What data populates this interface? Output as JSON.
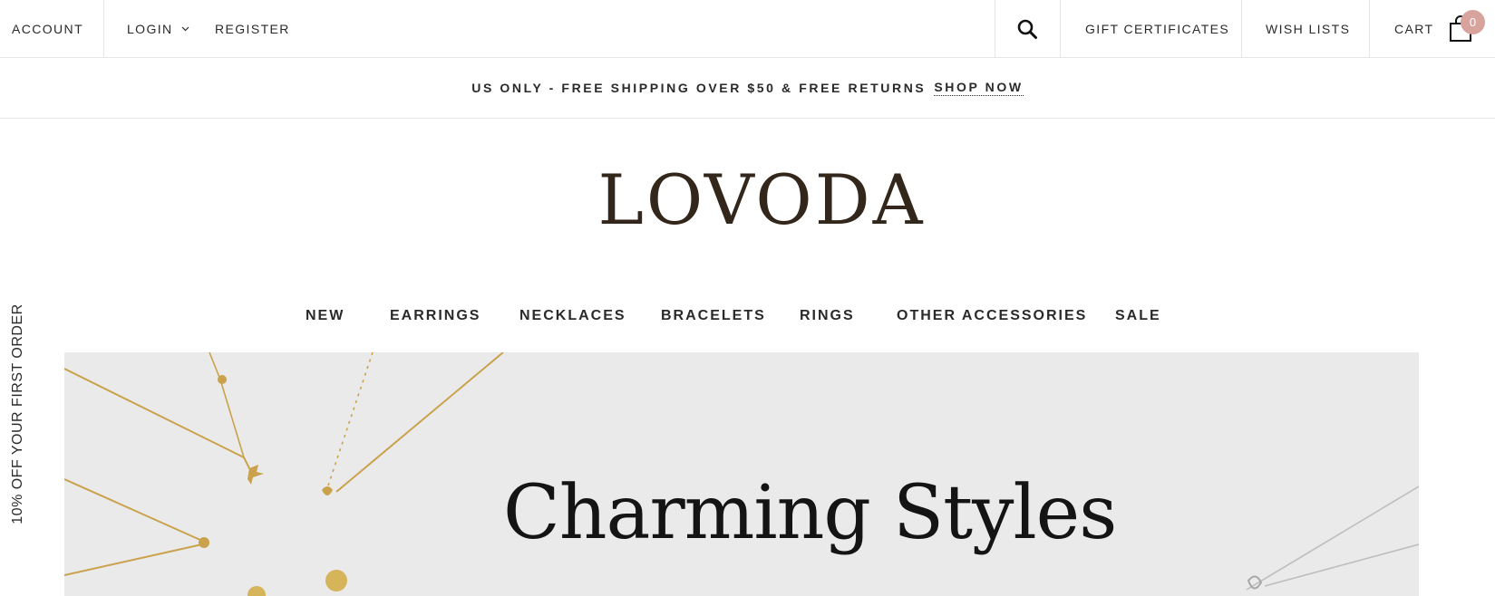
{
  "topbar": {
    "account": "ACCOUNT",
    "login": "LOGIN",
    "register": "REGISTER",
    "gift_certificates": "GIFT CERTIFICATES",
    "wish_lists": "WISH LISTS",
    "cart": "CART",
    "cart_count": "0"
  },
  "announcement": {
    "text": "US ONLY - FREE SHIPPING OVER $50 & FREE RETURNS",
    "link": "SHOP NOW"
  },
  "brand": {
    "logo": "LOVODA"
  },
  "nav": {
    "items": [
      {
        "label": "NEW"
      },
      {
        "label": "EARRINGS"
      },
      {
        "label": "NECKLACES"
      },
      {
        "label": "BRACELETS"
      },
      {
        "label": "RINGS"
      },
      {
        "label": "OTHER ACCESSORIES"
      },
      {
        "label": "SALE"
      }
    ]
  },
  "side_tab": {
    "label": "10% OFF YOUR FIRST ORDER"
  },
  "hero": {
    "title": "Charming Styles"
  },
  "colors": {
    "cart_badge": "#d7a39c",
    "logo": "#33261a",
    "hero_background": "#eaeaea",
    "jewelry_gold": "#c9a24b"
  },
  "icons": [
    "chevron-down-icon",
    "search-icon",
    "shopping-bag-icon"
  ]
}
